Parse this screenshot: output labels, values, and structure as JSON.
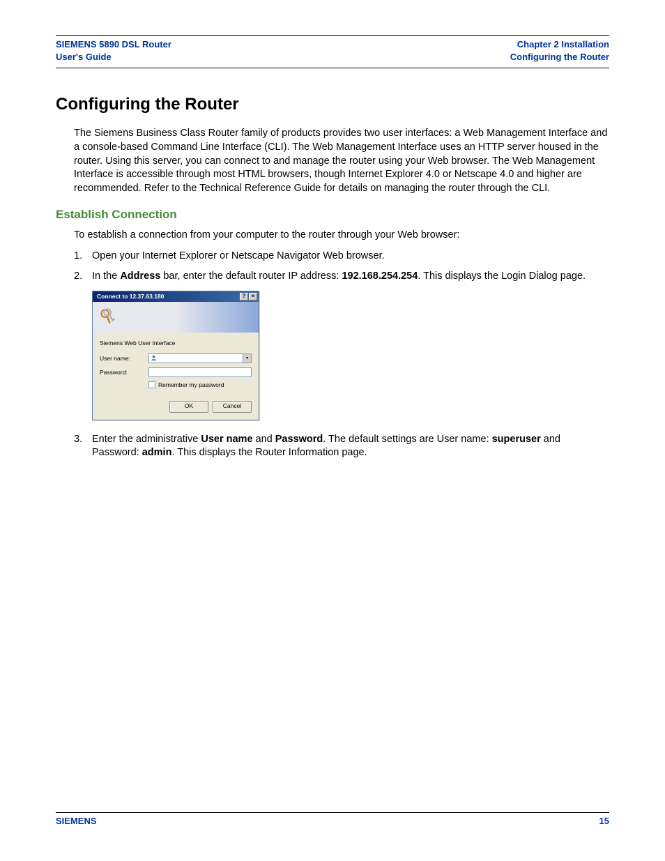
{
  "header": {
    "left_line1": "SIEMENS 5890 DSL Router",
    "left_line2": "User's Guide",
    "right_line1": "Chapter 2  Installation",
    "right_line2": "Configuring the Router"
  },
  "main_heading": "Configuring the Router",
  "intro_paragraph": "The Siemens Business Class Router family of products provides two user interfaces: a Web Management Interface and a console-based Command Line Interface (CLI). The Web Management Interface uses an HTTP server housed in the router. Using this server, you can connect to and manage the router using your Web browser. The Web Management Interface is accessible through most HTML browsers, though Internet Explorer 4.0 or Netscape 4.0 and higher are recommended. Refer to the Technical Reference Guide for details on managing the router through the CLI.",
  "sub_heading": "Establish Connection",
  "lead_text": "To establish a connection from your computer to the router through your Web browser:",
  "steps": {
    "s1_num": "1.",
    "s1_text": "Open your Internet Explorer or Netscape Navigator Web browser.",
    "s2_num": "2.",
    "s2_pre": "In the ",
    "s2_bold1": "Address",
    "s2_mid": " bar, enter the default router IP address: ",
    "s2_bold2": "192.168.254.254",
    "s2_post": ". This displays the Login Dialog page.",
    "s3_num": "3.",
    "s3_pre": "Enter the administrative ",
    "s3_bold1": "User name",
    "s3_mid1": " and ",
    "s3_bold2": "Password",
    "s3_mid2": ". The default settings are User name: ",
    "s3_bold3": "superuser",
    "s3_mid3": " and Password: ",
    "s3_bold4": "admin",
    "s3_post": ". This displays the Router Information page."
  },
  "dialog": {
    "title": "Connect to 12.37.63.180",
    "help_glyph": "?",
    "close_glyph": "×",
    "realm": "Siemens Web User Interface",
    "username_label": "User name:",
    "password_label": "Password:",
    "username_value": "",
    "password_value": "",
    "remember_label": "Remember my password",
    "drop_glyph": "▾",
    "ok_label": "OK",
    "cancel_label": "Cancel"
  },
  "footer": {
    "brand": "SIEMENS",
    "page": "15"
  }
}
